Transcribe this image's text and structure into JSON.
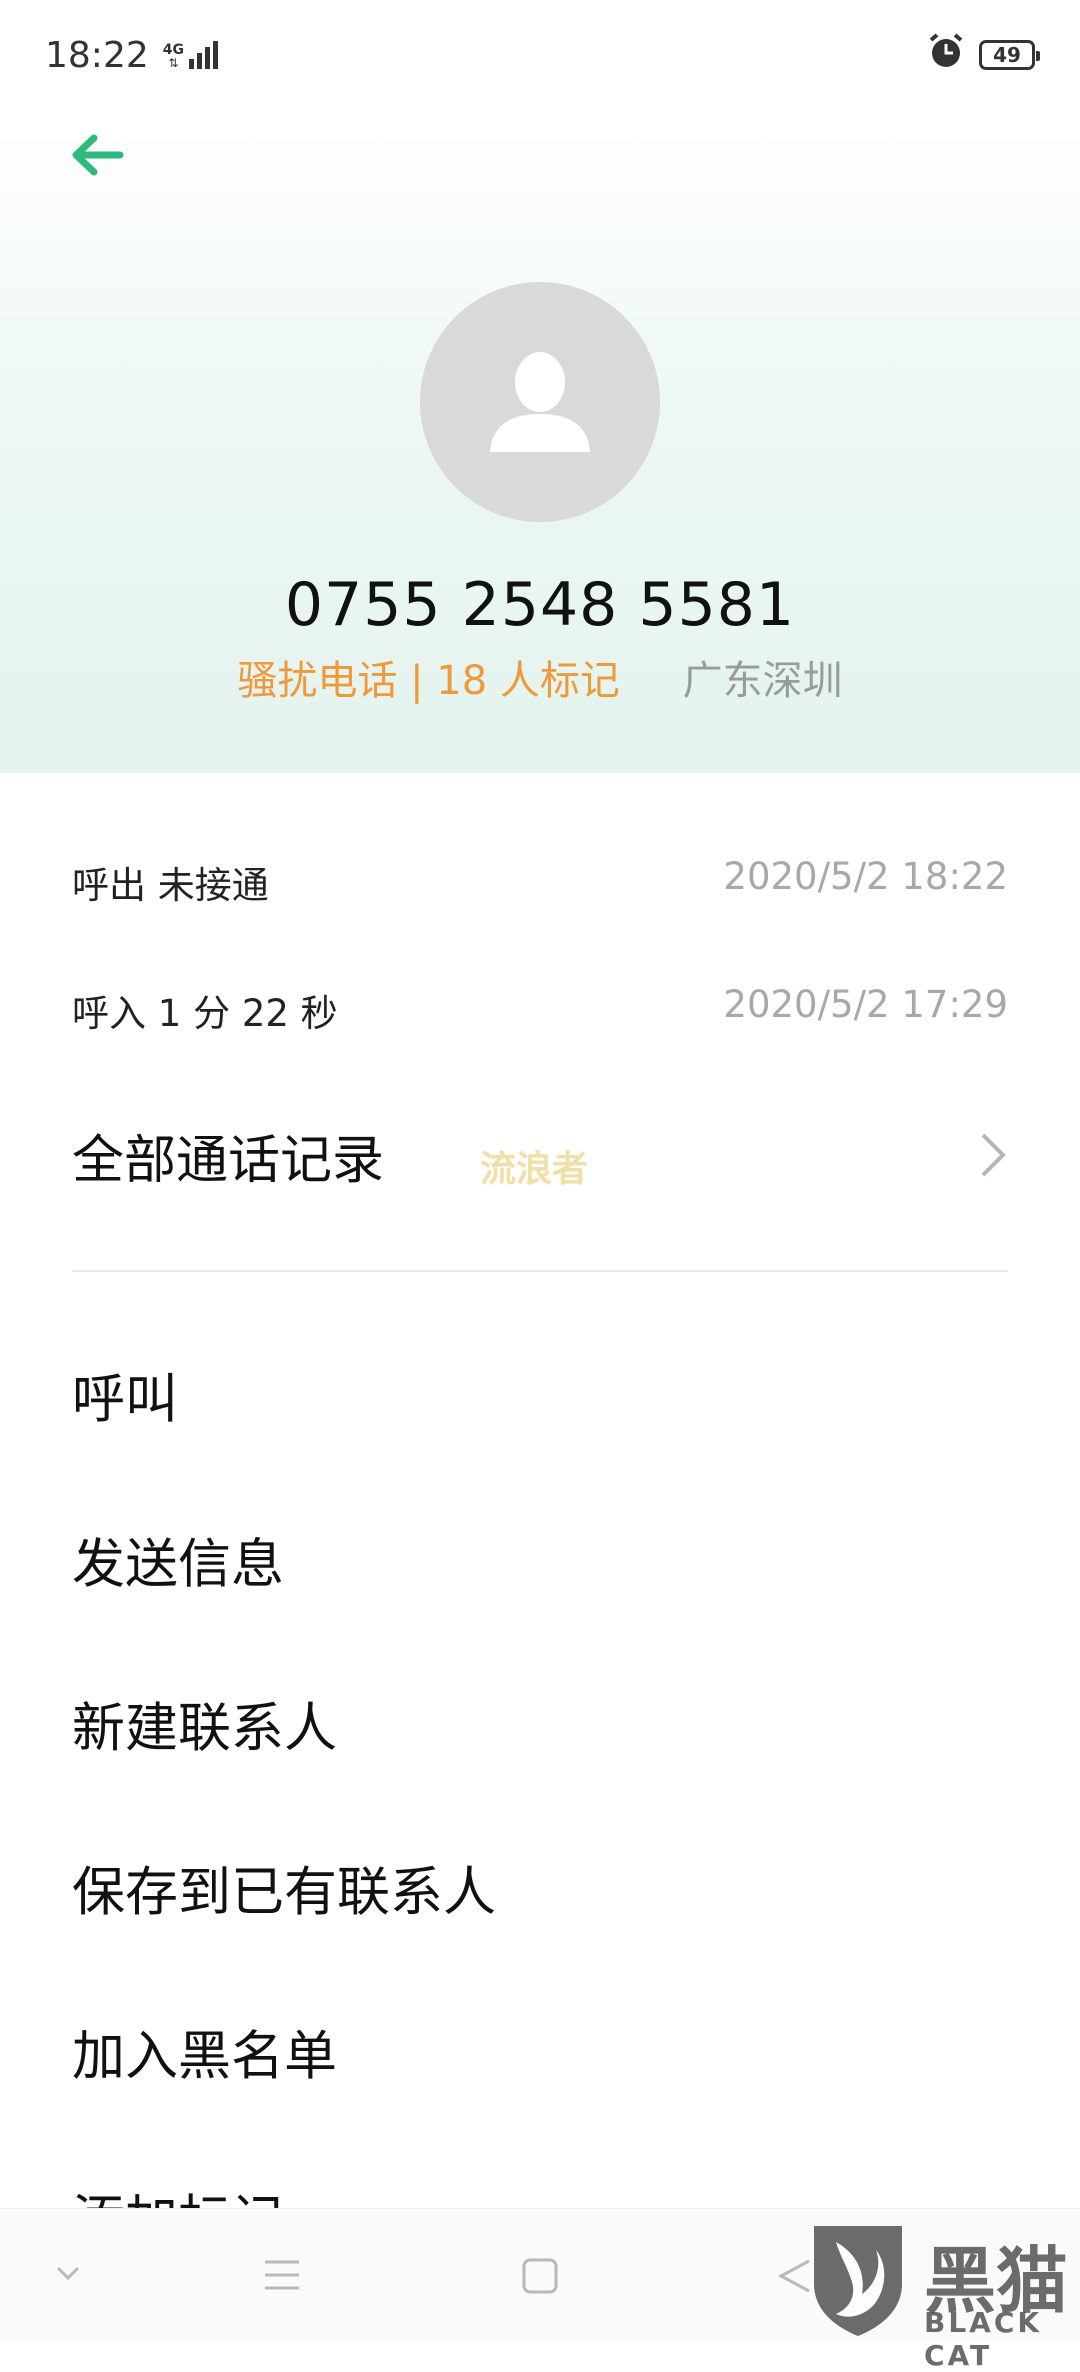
{
  "status_bar": {
    "time": "18:22",
    "network": "4G",
    "battery": "49",
    "icons": [
      "signal-icon",
      "alarm-icon",
      "battery-icon"
    ]
  },
  "header": {
    "phone_number": "0755 2548 5581",
    "tag": "骚扰电话 | 18 人标记",
    "location": "广东深圳",
    "accent_color": "#2dbb7d",
    "tag_color": "#ef9a3a"
  },
  "records": [
    {
      "label": "呼出 未接通",
      "time": "2020/5/2 18:22"
    },
    {
      "label": "呼入  1 分 22 秒",
      "time": "2020/5/2 17:29"
    }
  ],
  "all_records_label": "全部通话记录",
  "watermark": "流浪者",
  "actions": [
    "呼叫",
    "发送信息",
    "新建联系人",
    "保存到已有联系人",
    "加入黑名单",
    "添加标记"
  ],
  "brand": {
    "name": "黑猫",
    "sub": "BLACK CAT"
  }
}
